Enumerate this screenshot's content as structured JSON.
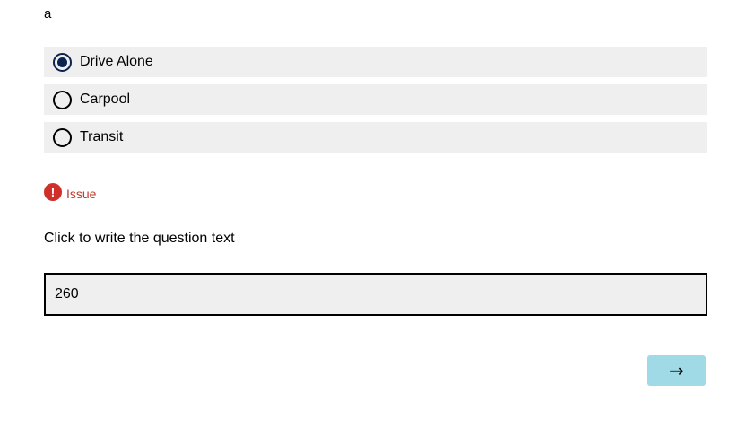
{
  "question": {
    "label": "a",
    "choices": [
      {
        "label": "Drive Alone",
        "selected": true
      },
      {
        "label": "Carpool",
        "selected": false
      },
      {
        "label": "Transit",
        "selected": false
      }
    ]
  },
  "validation": {
    "icon_symbol": "!",
    "message": "Issue",
    "color": "#d0302a"
  },
  "text_question": {
    "prompt": "Click to write the question text",
    "value": "260"
  },
  "navigation": {
    "next_label": "→",
    "next_color": "#9fdae6"
  },
  "colors": {
    "selected_radio": "#0a2350",
    "choice_background": "#efefef"
  }
}
